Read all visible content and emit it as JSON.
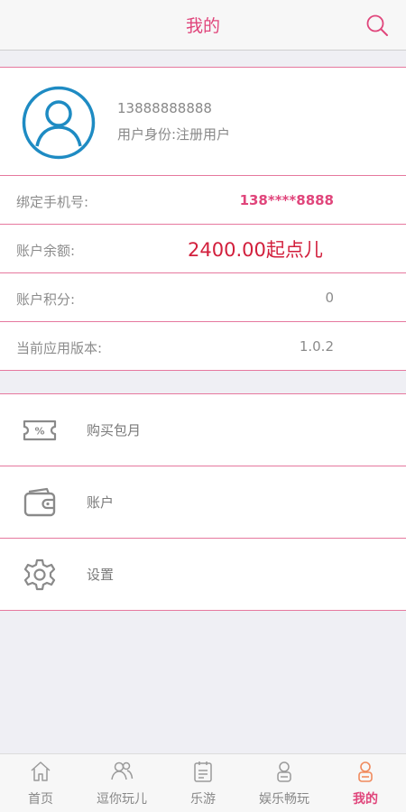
{
  "header": {
    "title": "我的"
  },
  "profile": {
    "phone": "13888888888",
    "role": "用户身份:注册用户"
  },
  "info": [
    {
      "label": "绑定手机号:",
      "value": "138****8888"
    },
    {
      "label": "账户余额:",
      "value": "2400.00起点儿"
    },
    {
      "label": "账户积分:",
      "value": "0"
    },
    {
      "label": "当前应用版本:",
      "value": "1.0.2"
    }
  ],
  "menu": [
    {
      "label": "购买包月",
      "icon": "coupon-icon"
    },
    {
      "label": "账户",
      "icon": "wallet-icon"
    },
    {
      "label": "设置",
      "icon": "gear-icon"
    }
  ],
  "tabs": [
    {
      "label": "首页",
      "icon": "home-icon"
    },
    {
      "label": "逗你玩儿",
      "icon": "users-icon"
    },
    {
      "label": "乐游",
      "icon": "calendar-icon"
    },
    {
      "label": "娱乐畅玩",
      "icon": "user-icon"
    },
    {
      "label": "我的",
      "icon": "profile-icon",
      "active": true
    }
  ],
  "colors": {
    "accent": "#e0457b",
    "balance": "#d21f3c",
    "avatar": "#1e8bc3",
    "divider": "#e6789e"
  }
}
